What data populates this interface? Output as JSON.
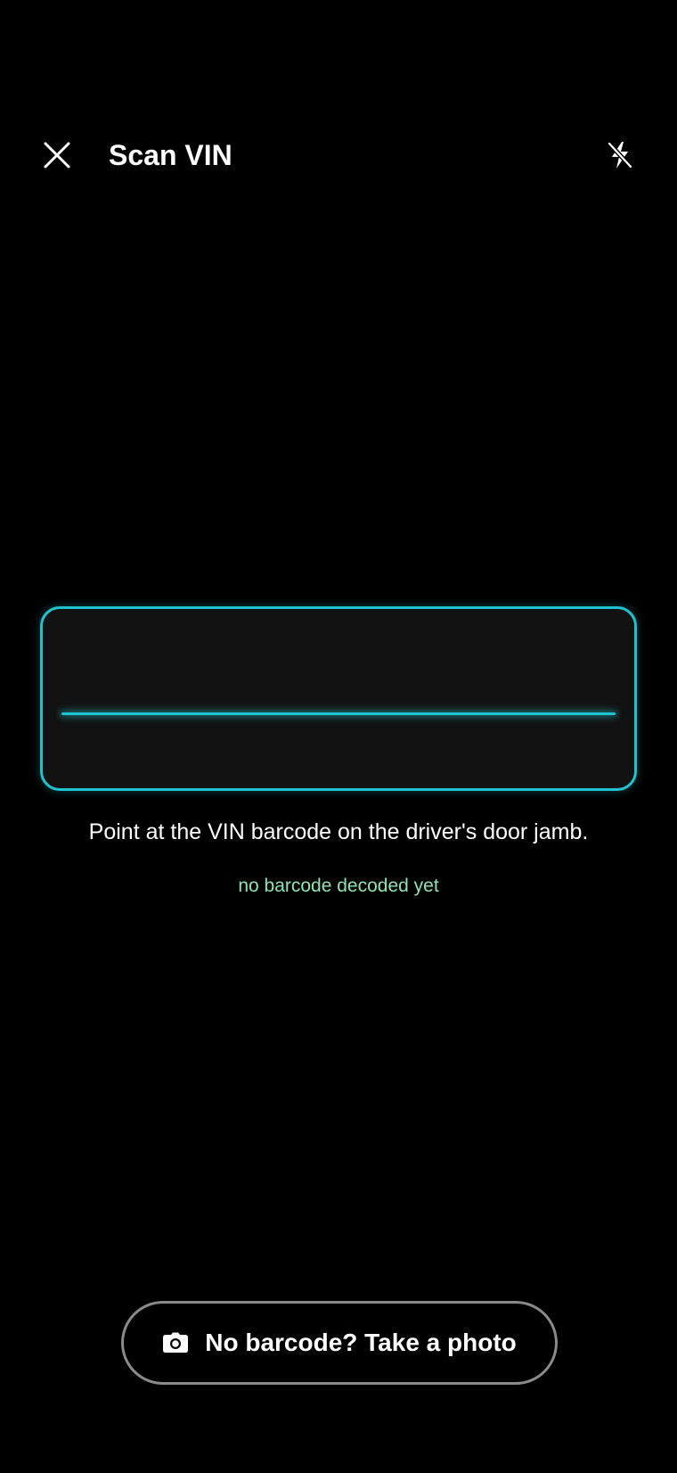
{
  "header": {
    "title": "Scan VIN",
    "close_icon": "close-icon",
    "flash_icon": "flash-off-icon"
  },
  "scanner": {
    "hint": "Point at the VIN barcode on the driver's door jamb.",
    "status": "no barcode decoded yet",
    "frame_color": "#1fc3cf",
    "status_color": "#8fe3b0"
  },
  "footer": {
    "photo_button_label": "No barcode? Take a photo",
    "photo_button_icon": "camera-icon"
  }
}
